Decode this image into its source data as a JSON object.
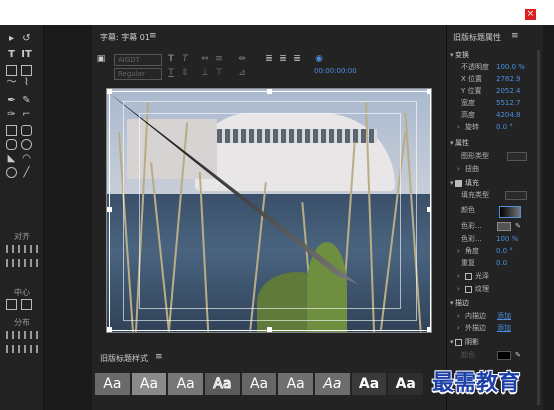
{
  "window": {
    "close_label": "×"
  },
  "tools": {
    "align_label": "对齐",
    "center_label": "中心",
    "distribute_label": "分布"
  },
  "center": {
    "tab_label": "字幕: 字幕 01",
    "tab_menu": "≡",
    "font_family": "AIGDT",
    "font_style": "Regular",
    "timecode": "00:00:00:00"
  },
  "styles": {
    "header": "旧版标题样式",
    "menu": "≡",
    "swatches": [
      "Aa",
      "Aa",
      "Aa",
      "Aa",
      "Aa",
      "Aa",
      "Aa",
      "Aa",
      "Aa"
    ]
  },
  "right": {
    "title": "旧版标题属性",
    "menu": "≡",
    "props": {
      "transform": "变换",
      "opacity_label": "不透明度",
      "opacity_value": "100.0 %",
      "xpos_label": "X 位置",
      "xpos_value": "2782.9",
      "ypos_label": "Y 位置",
      "ypos_value": "2052.4",
      "width_label": "宽度",
      "width_value": "5512.7",
      "height_label": "高度",
      "height_value": "4204.8",
      "rotate_label": "旋转",
      "rotate_value": "0.0 °",
      "attributes": "属性",
      "graphic_type": "图形类型",
      "distort": "扭曲",
      "fill": "填充",
      "fill_type": "填充类型",
      "color": "颜色",
      "color_stop_a": "色彩...",
      "color_stop_b": "色彩...",
      "color_stop_b_value": "100 %",
      "angle_label": "角度",
      "angle_value": "0.0 °",
      "repeat_label": "重复",
      "repeat_value": "0.0",
      "sheen": "光泽",
      "texture": "纹理",
      "stroke": "描边",
      "inner_stroke": "内描边",
      "inner_add": "添加",
      "outer_stroke": "外描边",
      "outer_add": "添加",
      "shadow": "阴影",
      "shadow_color": "颜色"
    }
  },
  "watermark": "最需教育",
  "colors": {
    "accent": "#4a90e2",
    "close": "#e02020",
    "watermark": "#1c3fa8"
  }
}
